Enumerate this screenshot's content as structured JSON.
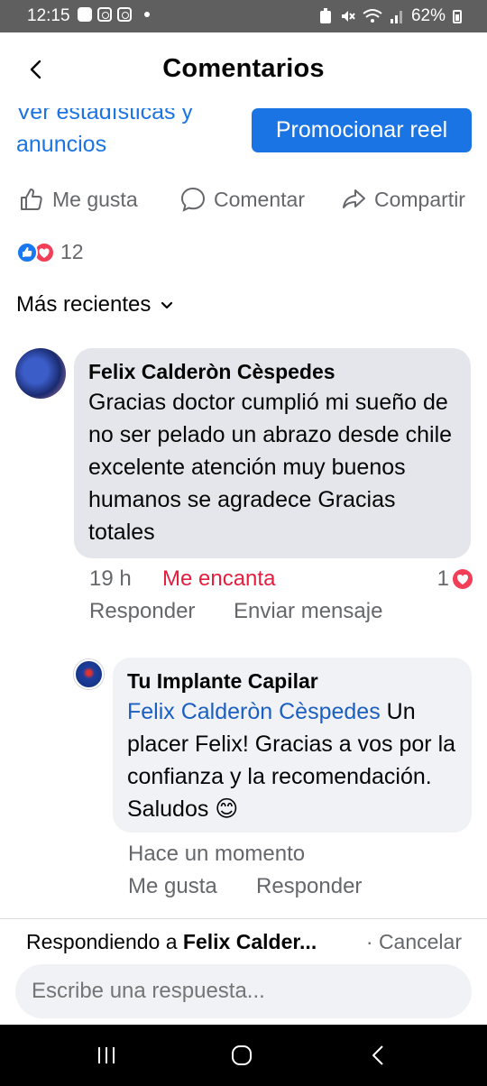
{
  "status_bar": {
    "time": "12:15",
    "battery": "62%"
  },
  "header": {
    "title": "Comentarios"
  },
  "post": {
    "stats_link": "Ver estadísticas y anuncios",
    "promote_label": "Promocionar reel",
    "actions": {
      "like": "Me gusta",
      "comment": "Comentar",
      "share": "Compartir"
    },
    "reaction_count": "12",
    "sort_label": "Más recientes"
  },
  "comments": [
    {
      "author": "Felix Calderòn Cèspedes",
      "text": "Gracias doctor cumplió mi sueño de no ser pelado un abrazo desde chile excelente atención muy buenos humanos se agradece     Gracias totales",
      "time": "19 h",
      "user_reaction": "Me encanta",
      "reaction_count": "1",
      "reply_label": "Responder",
      "message_label": "Enviar mensaje"
    },
    {
      "author": "Tu Implante Capilar",
      "mention": "Felix Calderòn Cèspedes",
      "text": "Un placer Felix! Gracias a vos por la confianza y la recomendación. Saludos 😊",
      "time": "Hace un momento",
      "like_label": "Me gusta",
      "reply_label": "Responder"
    }
  ],
  "composer": {
    "replying_prefix": "Respondiendo a",
    "replying_name": "Felix Calder...",
    "cancel_label": "· Cancelar",
    "placeholder": "Escribe una respuesta..."
  },
  "colors": {
    "accent": "#1b74e4",
    "love": "#e41e3f",
    "muted": "#65676b",
    "bubble": "#e4e6eb"
  }
}
